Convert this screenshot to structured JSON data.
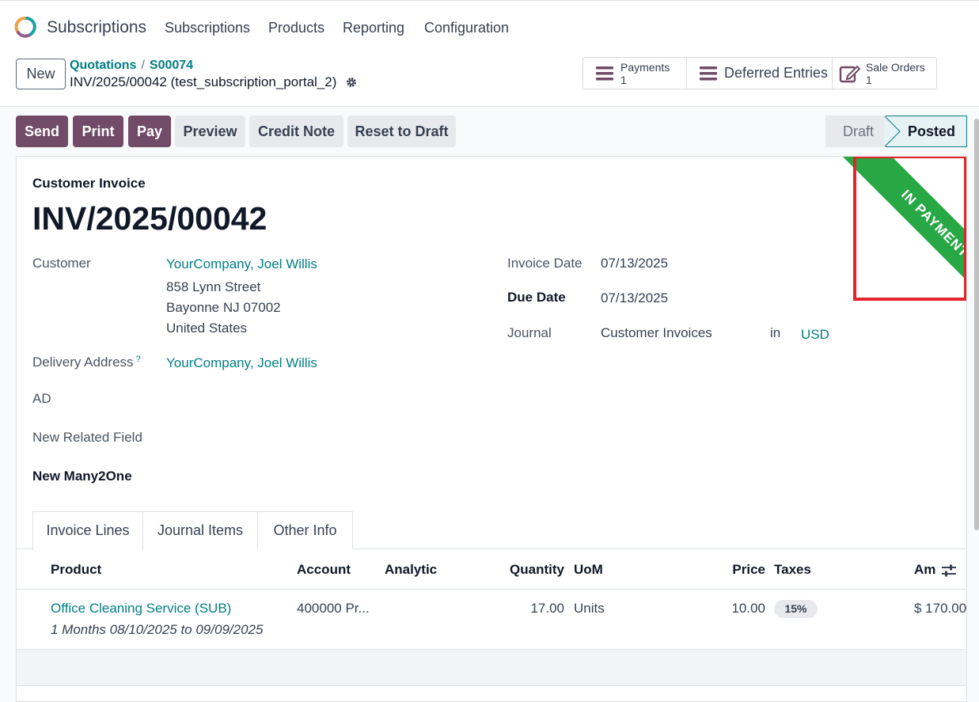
{
  "navbar": {
    "app_name": "Subscriptions",
    "menu": [
      "Subscriptions",
      "Products",
      "Reporting",
      "Configuration"
    ]
  },
  "control_panel": {
    "new_label": "New",
    "breadcrumbs": [
      "Quotations",
      "S00074"
    ],
    "breadcrumb_separator": "/",
    "record_title": "INV/2025/00042 (test_subscription_portal_2)",
    "smart_buttons": {
      "payments": {
        "label": "Payments",
        "value": "1",
        "icon": "list-icon"
      },
      "deferred": {
        "label": "Deferred Entries",
        "icon": "list-icon"
      },
      "sale_orders": {
        "label": "Sale Orders",
        "value": "1",
        "icon": "edit-document-icon"
      }
    }
  },
  "actions": {
    "send": "Send",
    "print": "Print",
    "pay": "Pay",
    "preview": "Preview",
    "credit_note": "Credit Note",
    "reset_to_draft": "Reset to Draft"
  },
  "status": {
    "draft": "Draft",
    "posted": "Posted",
    "current": "Posted"
  },
  "ribbon": {
    "text": "IN PAYMENT",
    "color": "#28a745"
  },
  "form": {
    "doc_type": "Customer Invoice",
    "doc_name": "INV/2025/00042",
    "customer": {
      "label": "Customer",
      "name": "YourCompany, Joel Willis",
      "street": "858 Lynn Street",
      "city_line": "Bayonne NJ 07002",
      "country": "United States"
    },
    "delivery_address": {
      "label": "Delivery Address",
      "help": "?",
      "value": "YourCompany, Joel Willis"
    },
    "ad_label": "AD",
    "new_related_field_label": "New Related Field",
    "new_many2one_label": "New Many2One",
    "invoice_date": {
      "label": "Invoice Date",
      "value": "07/13/2025"
    },
    "due_date": {
      "label": "Due Date",
      "value": "07/13/2025"
    },
    "journal": {
      "label": "Journal",
      "value": "Customer Invoices",
      "in_label": "in",
      "currency": "USD"
    }
  },
  "tabs": [
    "Invoice Lines",
    "Journal Items",
    "Other Info"
  ],
  "lines": {
    "headers": {
      "product": "Product",
      "account": "Account",
      "analytic": "Analytic",
      "quantity": "Quantity",
      "uom": "UoM",
      "price": "Price",
      "taxes": "Taxes",
      "amount": "Am"
    },
    "rows": [
      {
        "product": "Office Cleaning Service (SUB)",
        "description": "1 Months 08/10/2025 to 09/09/2025",
        "account": "400000 Pr...",
        "quantity": "17.00",
        "uom": "Units",
        "price": "10.00",
        "tax": "15%",
        "amount": "$ 170.00"
      }
    ]
  },
  "colors": {
    "primary": "#714b67",
    "link": "#017e84",
    "ribbon": "#28a745",
    "highlight": "#e3242b"
  }
}
